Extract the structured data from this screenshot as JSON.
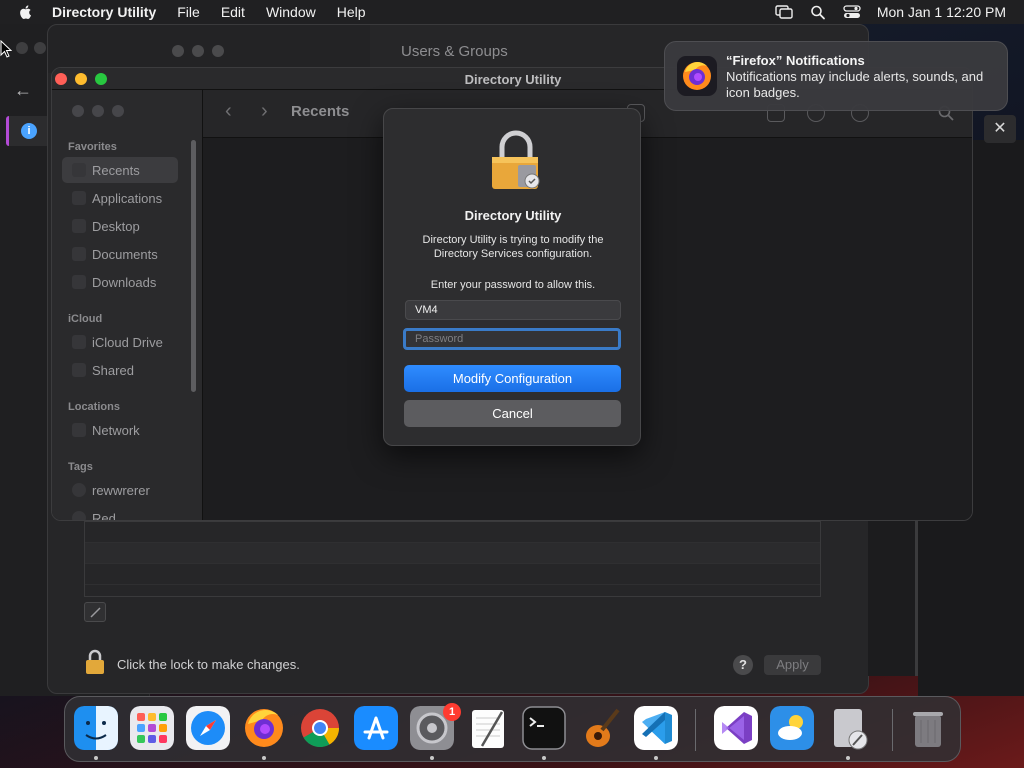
{
  "menubar": {
    "app_name": "Directory Utility",
    "items": [
      "File",
      "Edit",
      "Window",
      "Help"
    ],
    "clock": "Mon Jan 1  12:20 PM"
  },
  "users_window": {
    "title": "Users & Groups",
    "lock_text": "Click the lock to make changes.",
    "help_label": "?",
    "apply_label": "Apply"
  },
  "du_window": {
    "title": "Directory Utility",
    "breadcrumb": "Recents",
    "sidebar": {
      "sections": [
        {
          "label": "Favorites",
          "items": [
            "Recents",
            "Applications",
            "Desktop",
            "Documents",
            "Downloads"
          ]
        },
        {
          "label": "iCloud",
          "items": [
            "iCloud Drive",
            "Shared"
          ]
        },
        {
          "label": "Locations",
          "items": [
            "Network"
          ]
        },
        {
          "label": "Tags",
          "items": [
            "rewwrerer",
            "Red"
          ]
        }
      ],
      "selected": "Recents"
    }
  },
  "dialog": {
    "title": "Directory Utility",
    "message": "Directory Utility is trying to modify the Directory Services configuration.",
    "prompt": "Enter your password to allow this.",
    "username_value": "VM4",
    "password_placeholder": "Password",
    "primary_button": "Modify Configuration",
    "cancel_button": "Cancel"
  },
  "notification": {
    "title": "“Firefox” Notifications",
    "body": "Notifications may include alerts, sounds, and icon badges."
  },
  "dock": {
    "apps": [
      "finder-icon",
      "launchpad-icon",
      "safari-icon",
      "firefox-icon",
      "chrome-icon",
      "app-store-icon",
      "system-settings-icon",
      "textedit-icon",
      "terminal-icon",
      "garageband-icon",
      "vscode-icon",
      "visual-studio-icon",
      "weather-icon",
      "directory-utility-icon",
      "trash-icon"
    ],
    "settings_badge": "1"
  },
  "colors": {
    "accent": "#1a6fe6",
    "focus_ring": "#3a7bc8",
    "badge": "#ff3b30"
  }
}
